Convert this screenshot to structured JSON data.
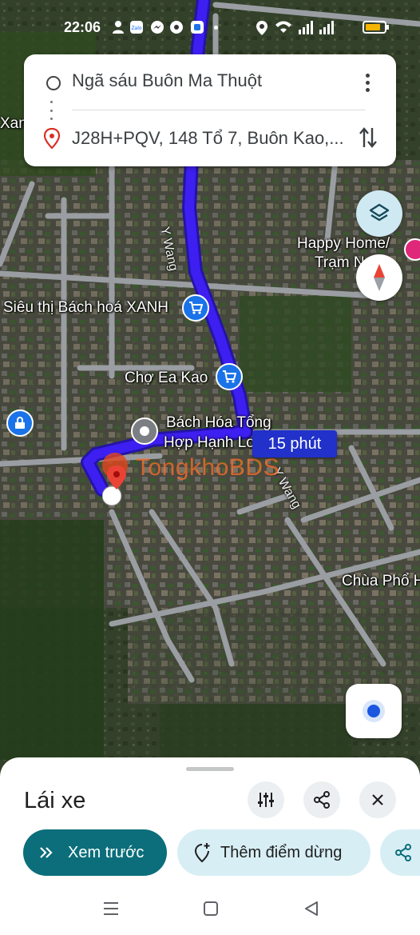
{
  "status_bar": {
    "time": "22:06",
    "icons": [
      "person-icon",
      "zalo-icon",
      "messenger-icon",
      "chrome-icon",
      "app-icon",
      "location-icon",
      "wifi-icon",
      "signal-icon",
      "battery-icon"
    ]
  },
  "directions": {
    "origin": "Ngã sáu Buôn Ma Thuột",
    "destination": "J28H+PQV, 148 Tổ 7, Buôn Kao,..."
  },
  "map": {
    "labels": {
      "xan": "Xan",
      "happy_home_1": "Happy Home/",
      "happy_home_2": "Trạm N",
      "sieu_thi": "Siêu thị Bách hoá XANH",
      "cho_ea_kao": "Chợ Ea Kao",
      "bach_hoa_1": "Bách Hóa Tổng",
      "bach_hoa_2": "Hợp Hạnh Lo",
      "chua": "Chùa Phổ H",
      "road_ywang_top": "Y Wang",
      "road_ywang_bottom": "Y Wang"
    },
    "duration": "15 phút",
    "watermark": "TongkhoBDS"
  },
  "sheet": {
    "title": "Lái xe",
    "preview_label": "Xem trước",
    "add_stop_label": "Thêm điểm dừng"
  },
  "colors": {
    "route": "#3d1ff2",
    "route_outline": "#2414a8",
    "primary_button": "#0b6e7a",
    "secondary_button": "#d7eef4"
  }
}
